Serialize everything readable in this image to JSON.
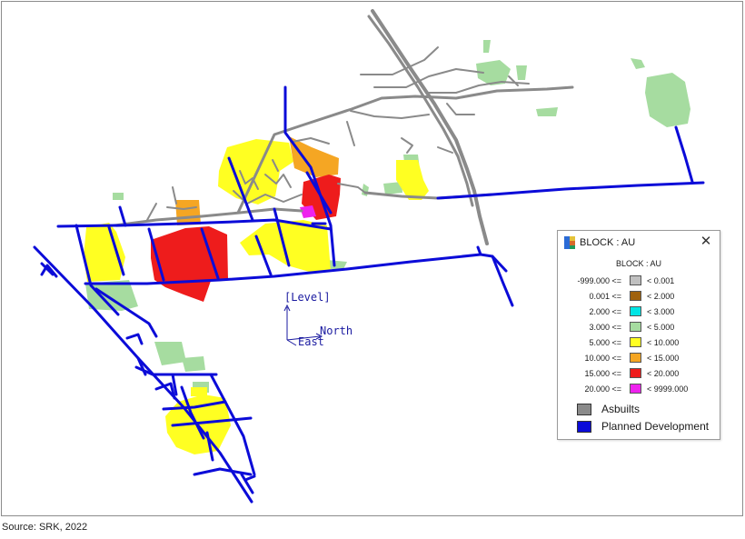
{
  "legend": {
    "window_title": "BLOCK : AU",
    "close_label": "✕",
    "header": "BLOCK : AU",
    "rows": [
      {
        "low": "-999.000 <=",
        "high": "< 0.001",
        "color": "#c0c0c0"
      },
      {
        "low": "0.001 <=",
        "high": "< 2.000",
        "color": "#a0620e"
      },
      {
        "low": "2.000 <=",
        "high": "< 3.000",
        "color": "#00e5e5"
      },
      {
        "low": "3.000 <=",
        "high": "< 5.000",
        "color": "#a6dca0"
      },
      {
        "low": "5.000 <=",
        "high": "< 10.000",
        "color": "#ffff22"
      },
      {
        "low": "10.000 <=",
        "high": "< 15.000",
        "color": "#f5a623"
      },
      {
        "low": "15.000 <=",
        "high": "< 20.000",
        "color": "#ee1c1c"
      },
      {
        "low": "20.000 <=",
        "high": "< 9999.000",
        "color": "#ee22ee"
      }
    ],
    "extras": [
      {
        "label": "Asbuilts",
        "color": "#8a8a8a"
      },
      {
        "label": "Planned Development",
        "color": "#0b0bd8"
      }
    ]
  },
  "axes": {
    "level": "[Level]",
    "north": "North",
    "east": "East"
  },
  "colors": {
    "asbuilts": "#8a8a8a",
    "planned": "#0b0bd8",
    "axis": "#1a1aa0"
  },
  "caption": "Source: SRK, 2022"
}
